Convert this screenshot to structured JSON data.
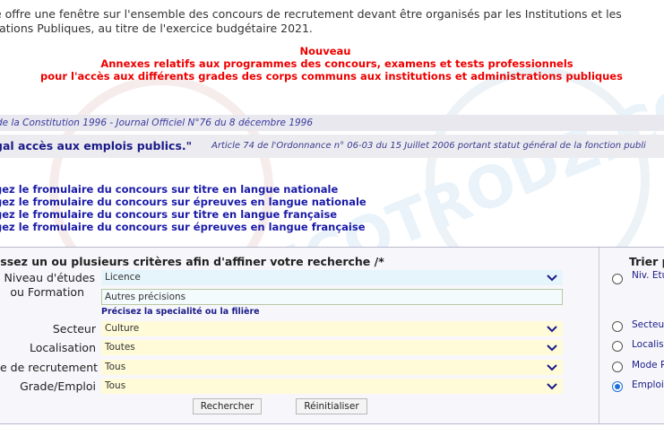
{
  "intro": {
    "line1": "e offre une fenêtre sur l'ensemble des concours de recrutement devant être organisés par les Institutions et les",
    "line2": "rations Publiques, au titre de l'exercice budgétaire 2021."
  },
  "nouveau": {
    "title": "Nouveau",
    "line1": "Annexes relatifs aux programmes des concours, examens et tests professionnels",
    "line2": "pour l'accès aux différents grades des corps communs aux institutions et administrations publiques"
  },
  "constitution_ref": "de la Constitution 1996 - Journal Officiel N°76 du 8 décembre 1996",
  "quote": "gal accès aux emplois publics.\"",
  "ordonnance_ref": "Article 74 de l'Ordonnance n° 06-03 du 15 Juillet 2006 portant statut général de la fonction publi",
  "links": [
    "gez le fromulaire du concours sur titre en langue nationale",
    "gez le fromulaire du concours sur épreuves en langue nationale",
    "gez le fromulaire du concours sur titre en langue française",
    "gez le fromulaire du concours sur épreuves en langue française"
  ],
  "search": {
    "title": "issez un ou plusieurs critères afin d'affiner votre recherche /*",
    "niveau_label_1": "Niveau d'études",
    "niveau_label_2": "ou Formation",
    "niveau_value": "Licence",
    "precisions_value": "Autres précisions",
    "precisions_hint": "Précisez la specialité ou la filière",
    "secteur_label": "Secteur",
    "secteur_value": "Culture",
    "localisation_label": "Localisation",
    "localisation_value": "Toutes",
    "mode_label": "e de recrutement",
    "mode_value": "Tous",
    "grade_label": "Grade/Emploi",
    "grade_value": "Tous",
    "search_button": "Rechercher",
    "reset_button": "Réinitialiser"
  },
  "sort": {
    "title": "Trier p",
    "options": [
      {
        "label": "Niv. Etu",
        "checked": false
      },
      {
        "label": "Secteu",
        "checked": false
      },
      {
        "label": "Localis",
        "checked": false
      },
      {
        "label": "Mode R",
        "checked": false
      },
      {
        "label": "Emploi",
        "checked": true
      }
    ]
  },
  "watermark": "WWW.ECOTRODZ.COM",
  "colors": {
    "alert_red": "#e00000",
    "link_blue": "#1a1aa8",
    "radio_blue": "#1a6fd8"
  }
}
